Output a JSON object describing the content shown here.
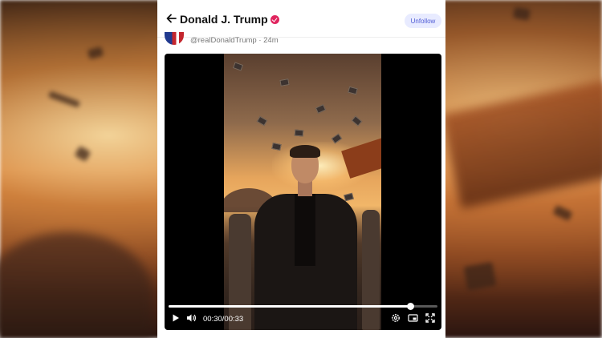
{
  "header": {
    "back_icon": "arrow-left-icon",
    "title": "Donald J. Trump",
    "verified_icon": "verified-badge-icon",
    "unfollow_label": "Unfollow"
  },
  "post": {
    "handle": "@realDonaldTrump",
    "separator": "·",
    "time_ago": "24m"
  },
  "video": {
    "current_time": "00:30",
    "time_separator": "/",
    "duration": "00:33",
    "progress": 0.9,
    "controls": [
      "play-icon",
      "volume-icon",
      "settings-icon",
      "picture-in-picture-icon",
      "fullscreen-icon"
    ]
  },
  "colors": {
    "accent": "#4f5bd5",
    "unfollow_bg": "#e8ebff",
    "verified": "#e0245e"
  }
}
